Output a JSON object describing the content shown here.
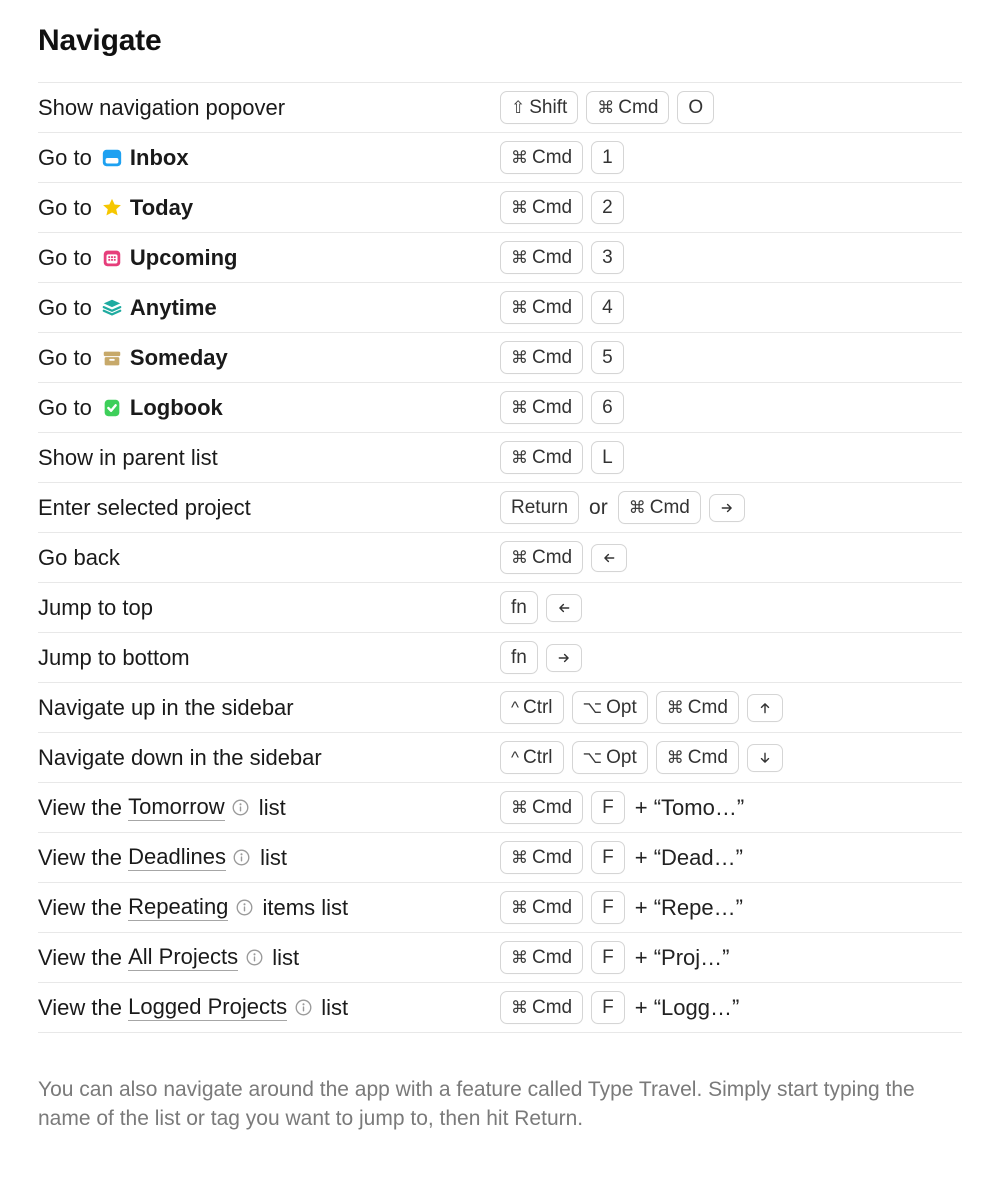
{
  "section_title": "Navigate",
  "keylabels": {
    "shift": "Shift",
    "cmd": "Cmd",
    "ctrl": "Ctrl",
    "opt": "Opt",
    "return": "Return",
    "fn": "fn"
  },
  "connectors": {
    "or": "or",
    "plus": "+"
  },
  "rows": [
    {
      "desc": {
        "prefix": "Show navigation popover"
      },
      "keys": [
        {
          "t": "key",
          "k": "shift"
        },
        {
          "t": "key",
          "k": "cmd"
        },
        {
          "t": "key",
          "k": "char",
          "v": "O"
        }
      ]
    },
    {
      "desc": {
        "prefix": "Go to ",
        "icon": "inbox",
        "bold": "Inbox"
      },
      "keys": [
        {
          "t": "key",
          "k": "cmd"
        },
        {
          "t": "key",
          "k": "char",
          "v": "1"
        }
      ]
    },
    {
      "desc": {
        "prefix": "Go to ",
        "icon": "star",
        "bold": "Today"
      },
      "keys": [
        {
          "t": "key",
          "k": "cmd"
        },
        {
          "t": "key",
          "k": "char",
          "v": "2"
        }
      ]
    },
    {
      "desc": {
        "prefix": "Go to ",
        "icon": "calendar",
        "bold": "Upcoming"
      },
      "keys": [
        {
          "t": "key",
          "k": "cmd"
        },
        {
          "t": "key",
          "k": "char",
          "v": "3"
        }
      ]
    },
    {
      "desc": {
        "prefix": "Go to ",
        "icon": "stack",
        "bold": "Anytime"
      },
      "keys": [
        {
          "t": "key",
          "k": "cmd"
        },
        {
          "t": "key",
          "k": "char",
          "v": "4"
        }
      ]
    },
    {
      "desc": {
        "prefix": "Go to ",
        "icon": "archive",
        "bold": "Someday"
      },
      "keys": [
        {
          "t": "key",
          "k": "cmd"
        },
        {
          "t": "key",
          "k": "char",
          "v": "5"
        }
      ]
    },
    {
      "desc": {
        "prefix": "Go to ",
        "icon": "logbook",
        "bold": "Logbook"
      },
      "keys": [
        {
          "t": "key",
          "k": "cmd"
        },
        {
          "t": "key",
          "k": "char",
          "v": "6"
        }
      ]
    },
    {
      "desc": {
        "prefix": "Show in parent list"
      },
      "keys": [
        {
          "t": "key",
          "k": "cmd"
        },
        {
          "t": "key",
          "k": "char",
          "v": "L"
        }
      ]
    },
    {
      "desc": {
        "prefix": "Enter selected project"
      },
      "keys": [
        {
          "t": "key",
          "k": "return"
        },
        {
          "t": "conn",
          "v": "or"
        },
        {
          "t": "key",
          "k": "cmd"
        },
        {
          "t": "key",
          "k": "arrow",
          "v": "right"
        }
      ]
    },
    {
      "desc": {
        "prefix": "Go back"
      },
      "keys": [
        {
          "t": "key",
          "k": "cmd"
        },
        {
          "t": "key",
          "k": "arrow",
          "v": "left"
        }
      ]
    },
    {
      "desc": {
        "prefix": "Jump to top"
      },
      "keys": [
        {
          "t": "key",
          "k": "fn"
        },
        {
          "t": "key",
          "k": "arrow",
          "v": "left"
        }
      ]
    },
    {
      "desc": {
        "prefix": "Jump to bottom"
      },
      "keys": [
        {
          "t": "key",
          "k": "fn"
        },
        {
          "t": "key",
          "k": "arrow",
          "v": "right"
        }
      ]
    },
    {
      "desc": {
        "prefix": "Navigate up in the sidebar"
      },
      "keys": [
        {
          "t": "key",
          "k": "ctrl"
        },
        {
          "t": "key",
          "k": "opt"
        },
        {
          "t": "key",
          "k": "cmd"
        },
        {
          "t": "key",
          "k": "arrow",
          "v": "up"
        }
      ]
    },
    {
      "desc": {
        "prefix": "Navigate down in the sidebar"
      },
      "keys": [
        {
          "t": "key",
          "k": "ctrl"
        },
        {
          "t": "key",
          "k": "opt"
        },
        {
          "t": "key",
          "k": "cmd"
        },
        {
          "t": "key",
          "k": "arrow",
          "v": "down"
        }
      ]
    },
    {
      "desc": {
        "prefix": "View the ",
        "link": "Tomorrow",
        "info": true,
        "suffix": " list"
      },
      "keys": [
        {
          "t": "key",
          "k": "cmd"
        },
        {
          "t": "key",
          "k": "char",
          "v": "F"
        },
        {
          "t": "typed",
          "v": "+ “Tomo…”"
        }
      ]
    },
    {
      "desc": {
        "prefix": "View the ",
        "link": "Deadlines",
        "info": true,
        "suffix": " list"
      },
      "keys": [
        {
          "t": "key",
          "k": "cmd"
        },
        {
          "t": "key",
          "k": "char",
          "v": "F"
        },
        {
          "t": "typed",
          "v": "+ “Dead…”"
        }
      ]
    },
    {
      "desc": {
        "prefix": "View the ",
        "link": "Repeating",
        "info": true,
        "suffix": " items list"
      },
      "keys": [
        {
          "t": "key",
          "k": "cmd"
        },
        {
          "t": "key",
          "k": "char",
          "v": "F"
        },
        {
          "t": "typed",
          "v": "+ “Repe…”"
        }
      ]
    },
    {
      "desc": {
        "prefix": "View the ",
        "link": "All Projects",
        "info": true,
        "suffix": " list"
      },
      "keys": [
        {
          "t": "key",
          "k": "cmd"
        },
        {
          "t": "key",
          "k": "char",
          "v": "F"
        },
        {
          "t": "typed",
          "v": "+ “Proj…”"
        }
      ]
    },
    {
      "desc": {
        "prefix": "View the ",
        "link": "Logged Projects",
        "info": true,
        "suffix": " list"
      },
      "keys": [
        {
          "t": "key",
          "k": "cmd"
        },
        {
          "t": "key",
          "k": "char",
          "v": "F"
        },
        {
          "t": "typed",
          "v": "+ “Logg…”"
        }
      ]
    }
  ],
  "footnote": "You can also navigate around the app with a feature called Type Travel. Simply start typing the name of the list or tag you want to jump to, then hit Return."
}
